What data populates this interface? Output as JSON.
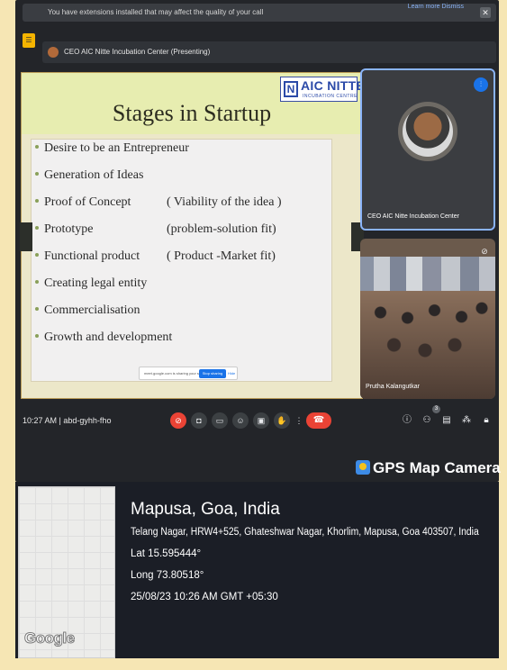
{
  "notice": {
    "text": "You have extensions installed that may affect the quality of your call",
    "links": "Learn more   Dismiss",
    "close": "✕"
  },
  "presenting_bar": {
    "label": "CEO AIC Nitte Incubation Center (Presenting)"
  },
  "slide": {
    "logo_name": "AIC NITTE",
    "logo_sub": "INCUBATION CENTRE",
    "title": "Stages in Startup",
    "bullets": [
      "Desire to be an Entrepreneur",
      "Generation of Ideas",
      "Proof of Concept",
      "Prototype",
      "Functional product",
      "Creating legal entity",
      "Commercialisation",
      "Growth and development"
    ],
    "notes": {
      "proof": "( Viability of the idea )",
      "prototype": "(problem-solution fit)",
      "functional": "( Product -Market fit)"
    },
    "share_popup": {
      "text": "meet.google.com is sharing your screen.",
      "stop": "Stop sharing",
      "hide": "Hide"
    }
  },
  "tiles": {
    "ceo_name": "CEO AIC Nitte Incubation Center",
    "room_name": "Prutha Kalangutkar"
  },
  "controls": {
    "time": "10:27 AM",
    "separator": "|",
    "meeting_code": "abd-gyhh-fho",
    "participants_count": "3"
  },
  "gps": {
    "brand": "GPS Map Camera",
    "location": "Mapusa, Goa, India",
    "address": "Telang Nagar, HRW4+525, Ghateshwar Nagar, Khorlim, Mapusa, Goa 403507, India",
    "lat": "Lat 15.595444°",
    "long": "Long 73.80518°",
    "datetime": "25/08/23 10:26 AM GMT +05:30",
    "map_label": "Google"
  },
  "colors": {
    "page_bg": "#f6e6b4",
    "meet_bg": "#232529",
    "accent_blue": "#8ab4f8",
    "hangup_red": "#ea4335",
    "slide_header": "#e7edb0"
  }
}
